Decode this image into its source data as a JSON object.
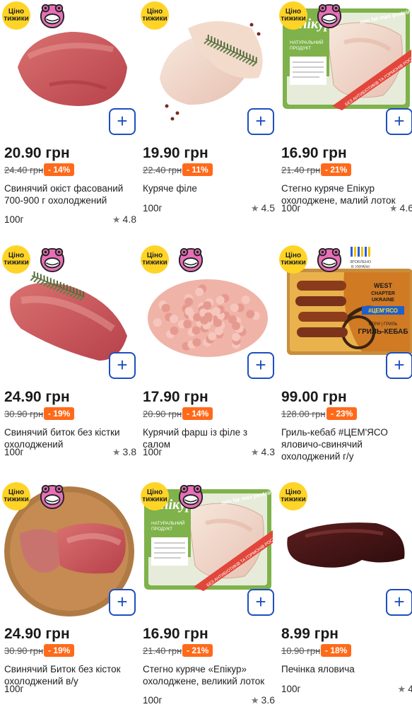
{
  "badges": {
    "price_badge": "Ціно\nтижики",
    "ukraine_badge": "ЗРОБЛЕНО\nВ УКРАЇНІ"
  },
  "products": [
    {
      "price": "20.90 грн",
      "old_price": "24.40 грн",
      "discount": "- 14%",
      "name": "Свинячий окіст фасований 700-900 г охолоджений",
      "weight": "100г",
      "rating": "4.8",
      "image": "pork-ham-raw",
      "mascot": true,
      "ua": false
    },
    {
      "price": "19.90 грн",
      "old_price": "22.40 грн",
      "discount": "- 11%",
      "name": "Куряче філе",
      "weight": "100г",
      "rating": "4.5",
      "image": "chicken-fillet",
      "mascot": false,
      "ua": false
    },
    {
      "price": "16.90 грн",
      "old_price": "21.40 грн",
      "discount": "- 21%",
      "name": "Стегно куряче Епікур охолоджене, малий лоток",
      "weight": "100г",
      "rating": "4.6",
      "image": "epikur-tray",
      "mascot": true,
      "ua": false
    },
    {
      "price": "24.90 грн",
      "old_price": "30.90 грн",
      "discount": "- 19%",
      "name": "Свинячий биток без кістки охолоджений",
      "weight": "100г",
      "rating": "3.8",
      "image": "pork-loin-rosemary",
      "mascot": true,
      "ua": false
    },
    {
      "price": "17.90 грн",
      "old_price": "20.90 грн",
      "discount": "- 14%",
      "name": "Курячий фарш із філе з салом",
      "weight": "100г",
      "rating": "4.3",
      "image": "minced-chicken",
      "mascot": true,
      "ua": false
    },
    {
      "price": "99.00 грн",
      "old_price": "128.00 грн",
      "discount": "- 23%",
      "name": "Гриль-кебаб #ЦЕМ'ЯСО яловичо-свинячий охолоджений г/у",
      "weight": "",
      "rating": "",
      "image": "grill-kebab-pack",
      "mascot": true,
      "ua": true
    },
    {
      "price": "24.90 грн",
      "old_price": "30.90 грн",
      "discount": "- 19%",
      "name": "Свинячий Биток без кісток охолоджений в/у",
      "weight": "100г",
      "rating": "",
      "image": "pork-on-board",
      "mascot": true,
      "ua": false
    },
    {
      "price": "16.90 грн",
      "old_price": "21.40 грн",
      "discount": "- 21%",
      "name": "Стегно куряче «Епікур» охолоджене, великий лоток",
      "weight": "100г",
      "rating": "3.6",
      "image": "epikur-tray",
      "mascot": true,
      "ua": false
    },
    {
      "price": "8.99 грн",
      "old_price": "10.90 грн",
      "discount": "- 18%",
      "name": "Печінка яловича",
      "weight": "100г",
      "rating": "4",
      "image": "beef-liver",
      "mascot": false,
      "ua": false
    }
  ],
  "colors": {
    "accent": "#1c4fbf",
    "discount": "#ff6a1a",
    "badge": "#ffd426"
  },
  "epikur": {
    "brand": "Епікур",
    "subtitle": "НАТУРАЛЬНИЙ ПРОДУКТ",
    "slogan": "min fat max protein",
    "band": "БЕЗ АНТИБІОТИКІВ ТА ГОРМОНІВ РОСТУ"
  },
  "kebab": {
    "brand": "WEST CHAPTER UKRAINE",
    "tag": "#ЦЕМ'ЯСО",
    "title": "ГРИЛЬ-КЕБАБ",
    "line": "БЕРИ | ГРИЛЬ"
  },
  "icons": {
    "add": "plus-icon",
    "star": "star-icon",
    "mascot": "mascot-icon"
  }
}
